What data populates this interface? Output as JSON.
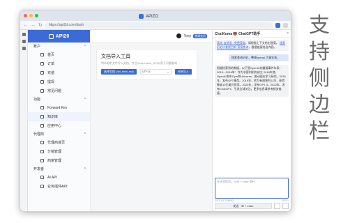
{
  "caption": [
    "支",
    "持",
    "侧",
    "边",
    "栏"
  ],
  "browser": {
    "tab_title": "APIZO",
    "url": "https://api2d.com/dash"
  },
  "app": {
    "brand": "API20",
    "user": "Tony",
    "badge": "普通会员"
  },
  "sidebar": {
    "groups": [
      {
        "label": "账户",
        "items": [
          "首页",
          "订单",
          "充值",
          "提现",
          "常见问题"
        ]
      },
      {
        "label": "功能",
        "items": [
          "Forward Key",
          "知识库",
          "应用中心"
        ]
      },
      {
        "label": "代理商",
        "items": [
          "代理商首页",
          "分销管理",
          "商家管理"
        ]
      },
      {
        "label": "开发者",
        "items": [
          "AI API",
          "业务插件API"
        ]
      }
    ]
  },
  "card": {
    "title": "文档导入工具",
    "desc": "将本地的文件导入文档，并且Searchable_API以用于问题查询",
    "file_btn": "选择文档 (.txt,.html,.md)",
    "encoding": "UTF-8",
    "upload_btn": "开始导入"
  },
  "chat": {
    "header": "ChatKuma 🐻 ChatGPT助手",
    "close": "×",
    "msg1_link1": "高效·自然语 · 免费获取",
    "msg1_rest": "，请根据上下文给出答案。",
    "msg1_link2": "搜索历史以查找目前·直接查询",
    "msg1_tail": "，根据链接给出内容。",
    "user_msg": "搜索查询历史，整理openai 大事年表。",
    "ai_answer": "根据检索到的数据，以下是OpenAI的重要事件年表：2015—2016年：作为非营利机构成立 2016年底，OpenAI发布Gym和Universe，推动强化学习研究。2018年，发布GPT模型。2019年，转为有限营利公司，获得微软10亿美元投资。2020年，发布GPT-3。2022年，发布ChatGPT，引发全球关注。更多信息请参考相关链接。",
    "placeholder": "在这里提问。Shift + enter 换行",
    "meta_left": "GPT-3.5-TURBO",
    "meta_right": "GPT+",
    "send": "发送 · ⌘ + enter"
  }
}
